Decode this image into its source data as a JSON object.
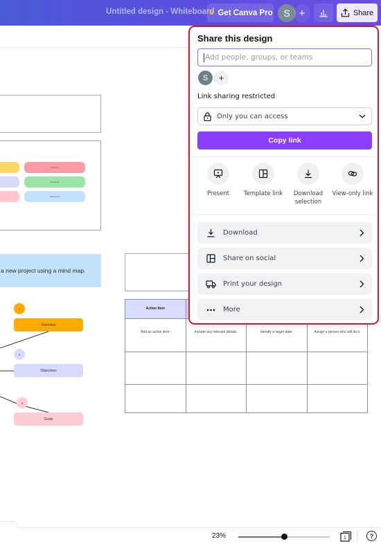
{
  "header": {
    "doc_title": "Untitled design - Whiteboard",
    "pro_button": "Get Canva Pro",
    "pro_icon": "crown-icon",
    "avatar_initial": "S",
    "add_collaborator": "+",
    "insights_icon": "bar-chart-icon",
    "share_button": "Share",
    "share_icon": "upload-icon"
  },
  "share_panel": {
    "title": "Share this design",
    "people_input": {
      "value": "",
      "placeholder": "Add people, groups, or teams"
    },
    "collaborators": [
      {
        "initial": "S"
      }
    ],
    "add_person": "+",
    "link_label": "Link sharing restricted",
    "access_select": {
      "value": "Only you can access",
      "icon": "lock-icon"
    },
    "copy_link": "Copy link",
    "quick_actions": [
      {
        "label": "Present",
        "icon": "present-icon"
      },
      {
        "label": "Template link",
        "icon": "template-icon"
      },
      {
        "label": "Download selection",
        "label_line1": "Download",
        "label_line2": "selection",
        "icon": "download-icon"
      },
      {
        "label": "View-only link",
        "icon": "link-icon"
      }
    ],
    "menu": [
      {
        "label": "Download",
        "icon": "download-icon"
      },
      {
        "label": "Share on social",
        "icon": "layout-icon"
      },
      {
        "label": "Print your design",
        "icon": "truck-icon"
      },
      {
        "label": "More",
        "icon": "more-dots-icon"
      }
    ]
  },
  "canvas": {
    "sticky_pills": [
      {
        "label": "Features",
        "color": "#fd9ba7"
      },
      {
        "label": "Deadlines",
        "color": "#9be6a6"
      },
      {
        "label": "Resources",
        "color": "#c3e1fd"
      }
    ],
    "left_pills_colors": [
      "#fed766",
      "#d7dafe",
      "#fdc7cf"
    ],
    "banner_text": "a new project using a mind map.",
    "mind_map": [
      {
        "number": "2",
        "label": "Overview",
        "color": "#fdab00",
        "dot_color": "#fdab00"
      },
      {
        "number": "3",
        "label": "Objectives",
        "color": "#d6dafd",
        "dot_color": "#d6dafd"
      },
      {
        "number": "4",
        "label": "Goals",
        "color": "#fdcdd4",
        "dot_color": "#fdcdd4"
      }
    ],
    "action_table": {
      "headers": [
        "Action Item",
        "",
        "",
        ""
      ],
      "rows": [
        [
          "Add an action item.",
          "Include any relevant details.",
          "Identify a target date.",
          "Assign a person who will do it."
        ],
        [
          "",
          "",
          "",
          ""
        ],
        [
          "",
          "",
          "",
          ""
        ]
      ]
    }
  },
  "footer": {
    "zoom_level": "23%",
    "zoom_fraction": 0.5,
    "page_count": "1",
    "help": "?"
  }
}
